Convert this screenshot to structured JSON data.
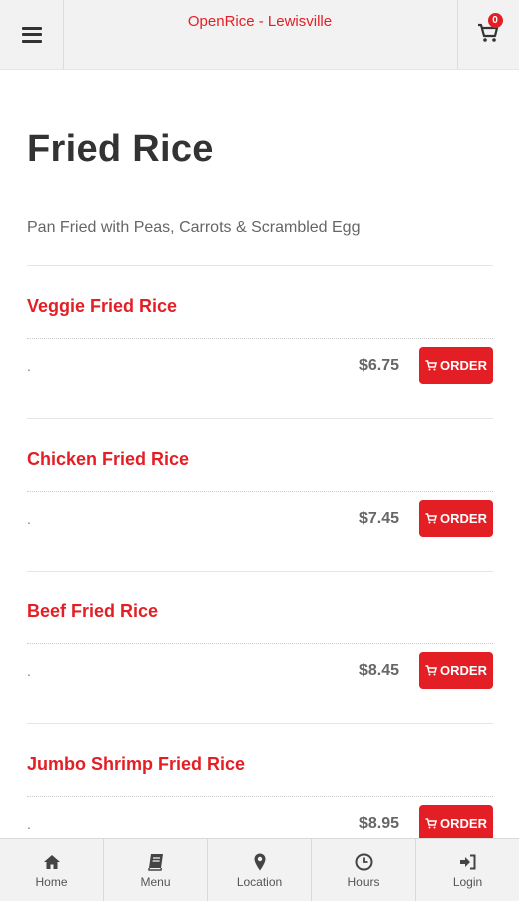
{
  "header": {
    "title": "OpenRice - Lewisville",
    "menu_icon": "hamburger-icon",
    "cart_icon": "cart-icon",
    "cart_count": "0"
  },
  "category": {
    "title": "Fried Rice",
    "description": "Pan Fried with Peas, Carrots & Scrambled Egg"
  },
  "items": [
    {
      "name": "Veggie Fried Rice",
      "description": ".",
      "price": "$6.75",
      "order_label": "ORDER"
    },
    {
      "name": "Chicken Fried Rice",
      "description": ".",
      "price": "$7.45",
      "order_label": "ORDER"
    },
    {
      "name": "Beef Fried Rice",
      "description": ".",
      "price": "$8.45",
      "order_label": "ORDER"
    },
    {
      "name": "Jumbo Shrimp Fried Rice",
      "description": ".",
      "price": "$8.95",
      "order_label": "ORDER"
    }
  ],
  "nav": [
    {
      "label": "Home",
      "icon": "home-icon"
    },
    {
      "label": "Menu",
      "icon": "book-icon"
    },
    {
      "label": "Location",
      "icon": "map-pin-icon"
    },
    {
      "label": "Hours",
      "icon": "clock-icon"
    },
    {
      "label": "Login",
      "icon": "sign-in-icon"
    }
  ],
  "colors": {
    "accent": "#e31e24",
    "header_bg": "#f2f2f2",
    "text": "#333333"
  }
}
